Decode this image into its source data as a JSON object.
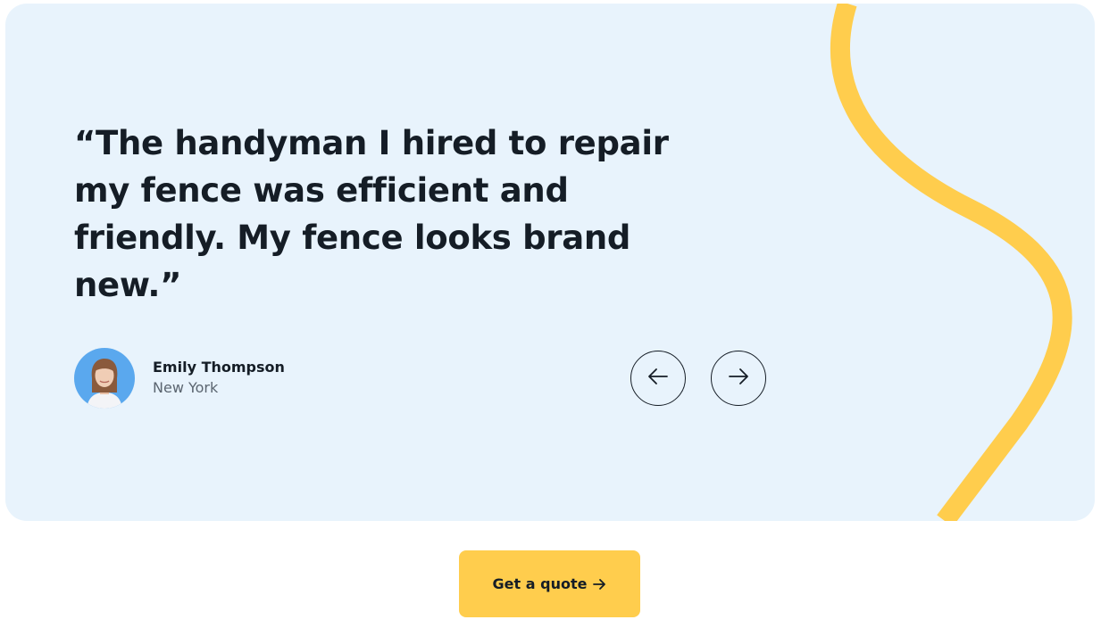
{
  "testimonial": {
    "quote": "“The handyman I hired to repair my fence was efficient and friendly. My fence looks brand new.”",
    "author_name": "Emily Thompson",
    "author_location": "New York"
  },
  "navigation": {
    "prev_icon": "arrow-left-icon",
    "next_icon": "arrow-right-icon"
  },
  "cta": {
    "label": "Get a quote",
    "icon": "arrow-right-icon"
  },
  "colors": {
    "card_background": "#e8f3fc",
    "accent_yellow": "#ffcd4d",
    "text_dark": "#151d26",
    "text_muted": "#5b6570"
  }
}
